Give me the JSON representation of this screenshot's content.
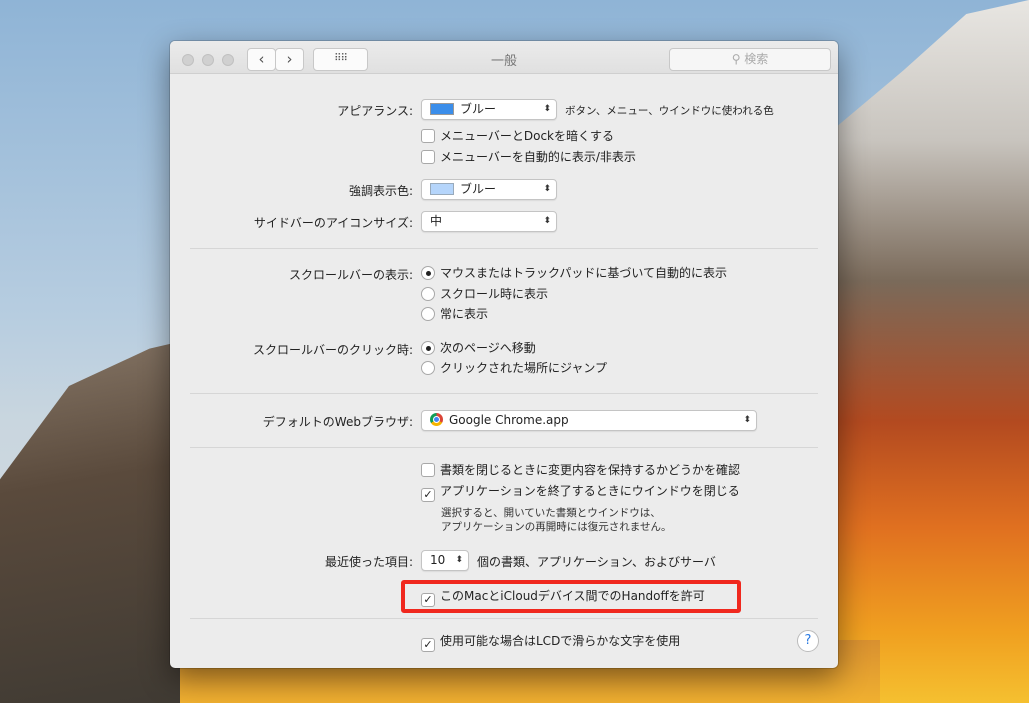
{
  "window": {
    "title": "一般",
    "search_placeholder": "検索"
  },
  "appearance": {
    "label": "アピアランス:",
    "value": "ブルー",
    "description": "ボタン、メニュー、ウインドウに使われる色",
    "color": "#3b8eea"
  },
  "dark_menu": {
    "label": "メニューバーとDockを暗くする",
    "checked": false
  },
  "auto_hide_menu": {
    "label": "メニューバーを自動的に表示/非表示",
    "checked": false
  },
  "highlight": {
    "label": "強調表示色:",
    "value": "ブルー",
    "color": "#b5d5fb"
  },
  "sidebar_icon_size": {
    "label": "サイドバーのアイコンサイズ:",
    "value": "中"
  },
  "scrollbar_show": {
    "label": "スクロールバーの表示:",
    "options": [
      "マウスまたはトラックパッドに基づいて自動的に表示",
      "スクロール時に表示",
      "常に表示"
    ],
    "selected": 0
  },
  "scrollbar_click": {
    "label": "スクロールバーのクリック時:",
    "options": [
      "次のページへ移動",
      "クリックされた場所にジャンプ"
    ],
    "selected": 0
  },
  "browser": {
    "label": "デフォルトのWebブラウザ:",
    "value": "Google Chrome.app"
  },
  "ask_keep_changes": {
    "label": "書類を閉じるときに変更内容を保持するかどうかを確認",
    "checked": false
  },
  "close_windows": {
    "label": "アプリケーションを終了するときにウインドウを閉じる",
    "checked": true
  },
  "close_windows_note": [
    "選択すると、開いていた書類とウインドウは、",
    "アプリケーションの再開時には復元されません。"
  ],
  "recent_items": {
    "label": "最近使った項目:",
    "value": "10",
    "suffix": "個の書類、アプリケーション、およびサーバ"
  },
  "handoff": {
    "label": "このMacとiCloudデバイス間でのHandoffを許可",
    "checked": true
  },
  "lcd_smoothing": {
    "label": "使用可能な場合はLCDで滑らかな文字を使用",
    "checked": true
  },
  "help_label": "?",
  "check_mark": "✓"
}
